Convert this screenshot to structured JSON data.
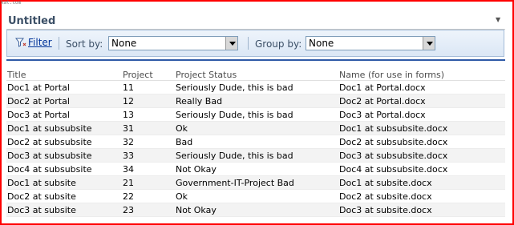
{
  "watermark": "kat.com",
  "webpart": {
    "title": "Untitled"
  },
  "toolbar": {
    "filter_label": "Filter",
    "sort_label": "Sort by:",
    "sort_value": "None",
    "group_label": "Group by:",
    "group_value": "None"
  },
  "table": {
    "headers": [
      "Title",
      "Project",
      "Project Status",
      "Name (for use in forms)"
    ],
    "rows": [
      [
        "Doc1 at Portal",
        "11",
        "Seriously Dude, this is bad",
        "Doc1 at Portal.docx"
      ],
      [
        "Doc2 at Portal",
        "12",
        "Really Bad",
        "Doc2 at Portal.docx"
      ],
      [
        "Doc3 at Portal",
        "13",
        "Seriously Dude, this is bad",
        "Doc3 at Portal.docx"
      ],
      [
        "Doc1 at subsubsite",
        "31",
        "Ok",
        "Doc1 at subsubsite.docx"
      ],
      [
        "Doc2 at subsubsite",
        "32",
        "Bad",
        "Doc2 at subsubsite.docx"
      ],
      [
        "Doc3 at subsubsite",
        "33",
        "Seriously Dude, this is bad",
        "Doc3 at subsubsite.docx"
      ],
      [
        "Doc4 at subsubsite",
        "34",
        "Not Okay",
        "Doc4 at subsubsite.docx"
      ],
      [
        "Doc1 at subsite",
        "21",
        "Government-IT-Project Bad",
        "Doc1 at subsite.docx"
      ],
      [
        "Doc2 at subsite",
        "22",
        "Ok",
        "Doc2 at subsite.docx"
      ],
      [
        "Doc3 at subsite",
        "23",
        "Not Okay",
        "Doc3 at subsite.docx"
      ]
    ]
  },
  "colors": {
    "frame": "#ff0000",
    "accent": "#2f5aa7",
    "title": "#3b4f66"
  }
}
